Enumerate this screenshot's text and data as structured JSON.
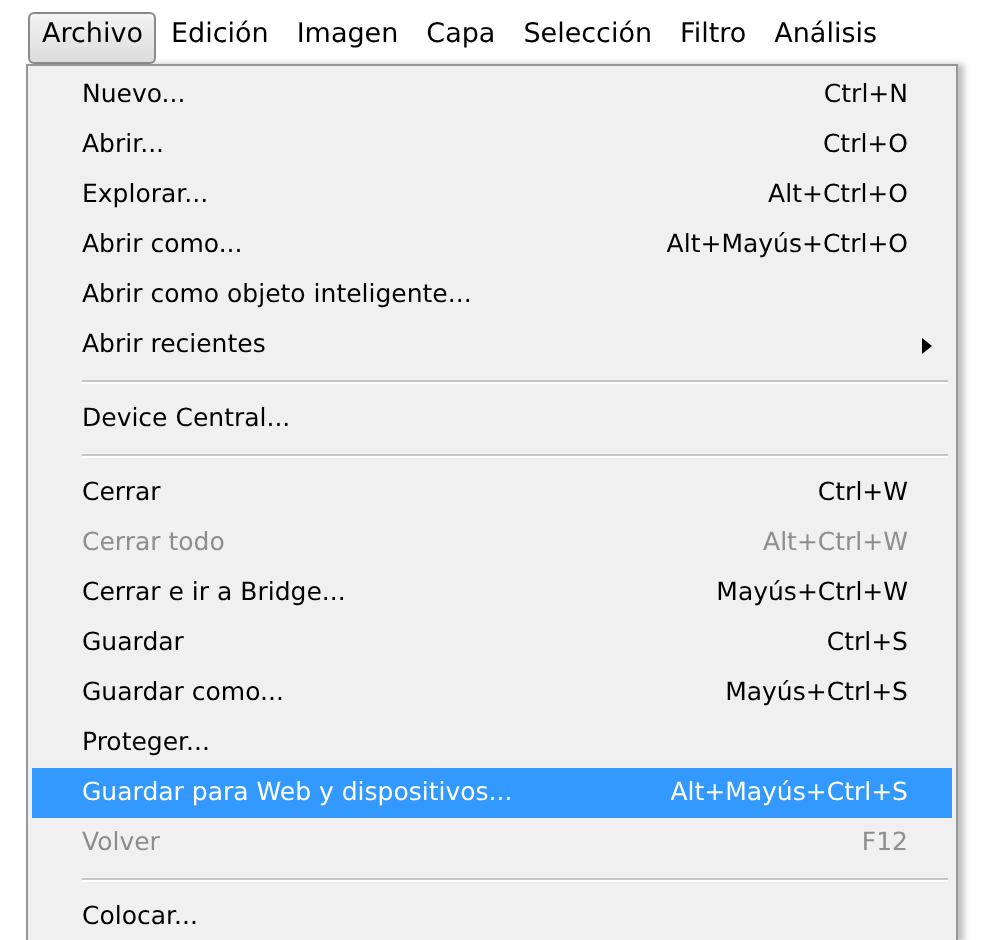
{
  "menubar": [
    {
      "label": "Archivo",
      "selected": true
    },
    {
      "label": "Edición",
      "selected": false
    },
    {
      "label": "Imagen",
      "selected": false
    },
    {
      "label": "Capa",
      "selected": false
    },
    {
      "label": "Selección",
      "selected": false
    },
    {
      "label": "Filtro",
      "selected": false
    },
    {
      "label": "Análisis",
      "selected": false
    }
  ],
  "menu": [
    {
      "kind": "item",
      "label": "Nuevo...",
      "shortcut": "Ctrl+N",
      "disabled": false,
      "selected": false,
      "has_submenu": false
    },
    {
      "kind": "item",
      "label": "Abrir...",
      "shortcut": "Ctrl+O",
      "disabled": false,
      "selected": false,
      "has_submenu": false
    },
    {
      "kind": "item",
      "label": "Explorar...",
      "shortcut": "Alt+Ctrl+O",
      "disabled": false,
      "selected": false,
      "has_submenu": false
    },
    {
      "kind": "item",
      "label": "Abrir como...",
      "shortcut": "Alt+Mayús+Ctrl+O",
      "disabled": false,
      "selected": false,
      "has_submenu": false
    },
    {
      "kind": "item",
      "label": "Abrir como objeto inteligente...",
      "disabled": false,
      "selected": false,
      "has_submenu": false
    },
    {
      "kind": "item",
      "label": "Abrir recientes",
      "disabled": false,
      "selected": false,
      "has_submenu": true
    },
    {
      "kind": "separator"
    },
    {
      "kind": "item",
      "label": "Device Central...",
      "disabled": false,
      "selected": false,
      "has_submenu": false
    },
    {
      "kind": "separator"
    },
    {
      "kind": "item",
      "label": "Cerrar",
      "shortcut": "Ctrl+W",
      "disabled": false,
      "selected": false,
      "has_submenu": false
    },
    {
      "kind": "item",
      "label": "Cerrar todo",
      "shortcut": "Alt+Ctrl+W",
      "disabled": true,
      "selected": false,
      "has_submenu": false
    },
    {
      "kind": "item",
      "label": "Cerrar e ir a Bridge...",
      "shortcut": "Mayús+Ctrl+W",
      "disabled": false,
      "selected": false,
      "has_submenu": false
    },
    {
      "kind": "item",
      "label": "Guardar",
      "shortcut": "Ctrl+S",
      "disabled": false,
      "selected": false,
      "has_submenu": false
    },
    {
      "kind": "item",
      "label": "Guardar como...",
      "shortcut": "Mayús+Ctrl+S",
      "disabled": false,
      "selected": false,
      "has_submenu": false
    },
    {
      "kind": "item",
      "label": "Proteger...",
      "disabled": false,
      "selected": false,
      "has_submenu": false
    },
    {
      "kind": "item",
      "label": "Guardar para Web y dispositivos...",
      "shortcut": "Alt+Mayús+Ctrl+S",
      "disabled": false,
      "selected": true,
      "has_submenu": false
    },
    {
      "kind": "item",
      "label": "Volver",
      "shortcut": "F12",
      "disabled": true,
      "selected": false,
      "has_submenu": false
    },
    {
      "kind": "separator"
    },
    {
      "kind": "item",
      "label": "Colocar...",
      "disabled": false,
      "selected": false,
      "has_submenu": false
    }
  ]
}
